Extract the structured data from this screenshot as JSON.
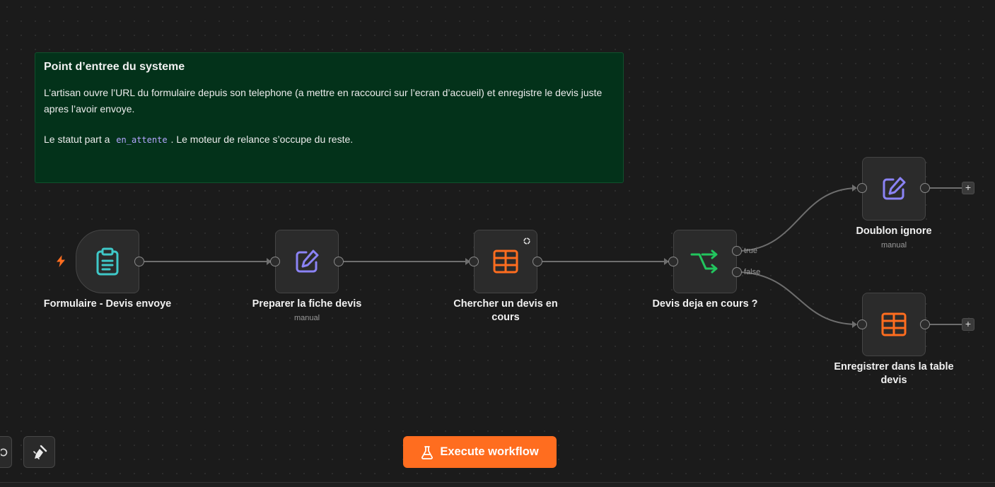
{
  "sticky_note": {
    "title": "Point d’entree du systeme",
    "paragraph1": "L’artisan ouvre l’URL du formulaire depuis son telephone (a mettre en raccourci sur l’ecran d’accueil) et enregistre le devis juste apres l’avoir envoye.",
    "paragraph2_before": "Le statut part a",
    "paragraph2_code": "en_attente",
    "paragraph2_after": ". Le moteur de relance s’occupe du reste."
  },
  "nodes": {
    "form_trigger": {
      "label": "Formulaire - Devis envoye",
      "icon": "clipboard-icon",
      "color": "#3fc8c8"
    },
    "prepare": {
      "label": "Preparer la fiche devis",
      "sublabel": "manual",
      "icon": "edit-icon",
      "color": "#8b83f5"
    },
    "search": {
      "label": "Chercher un devis en cours",
      "icon": "table-icon",
      "color": "#ff6d1f"
    },
    "if_node": {
      "label": "Devis deja en cours ?",
      "icon": "branch-icon",
      "color": "#22c55e"
    },
    "duplicate": {
      "label": "Doublon ignore",
      "sublabel": "manual",
      "icon": "edit-icon",
      "color": "#8b83f5"
    },
    "save": {
      "label": "Enregistrer dans la table devis",
      "icon": "table-icon",
      "color": "#ff6d1f"
    }
  },
  "branches": {
    "true_label": "true",
    "false_label": "false"
  },
  "buttons": {
    "execute_label": "Execute workflow",
    "plus": "+"
  },
  "colors": {
    "accent": "#ff6d1f",
    "canvas": "#1b1b1b",
    "sticky": "#03321a",
    "trigger_bolt": "#ff6d1f"
  }
}
